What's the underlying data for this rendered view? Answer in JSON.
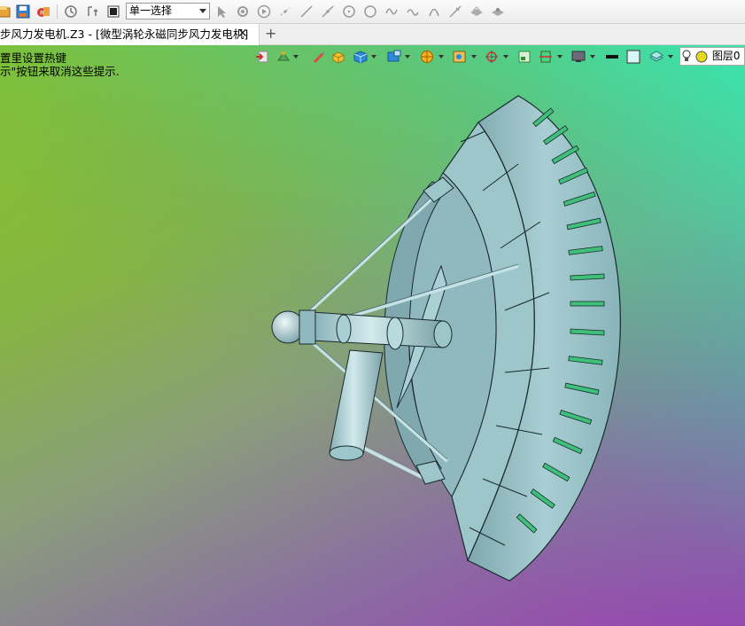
{
  "toolbar": {
    "selection_mode": "单一选择"
  },
  "tabs": [
    {
      "label": "步风力发电机.Z3 - [微型涡轮永磁同步风力发电机]"
    }
  ],
  "viewport": {
    "hint_line1": "置里设置热键",
    "hint_line2": "示\"按钮来取消这些提示.",
    "layer_label": "图层0",
    "colors": {
      "background_top_left": "#84c52a",
      "background_top_right": "#34e8b4",
      "background_bottom_left": "#9a3fb2",
      "model_surface": "#9dc4c8",
      "model_edges": "#1a2a2e",
      "vent_slots": "#3ec07a"
    }
  }
}
